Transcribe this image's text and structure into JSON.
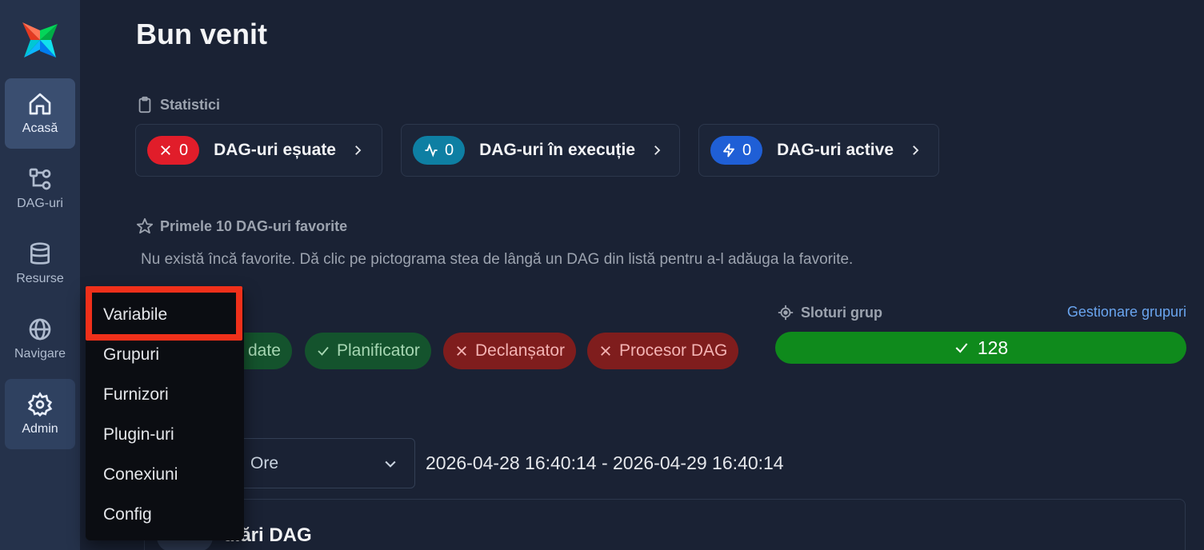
{
  "sidebar": {
    "items": [
      {
        "label": "Acasă",
        "icon": "home-icon"
      },
      {
        "label": "DAG-uri",
        "icon": "dag-icon"
      },
      {
        "label": "Resurse",
        "icon": "database-icon"
      },
      {
        "label": "Navigare",
        "icon": "globe-icon"
      },
      {
        "label": "Admin",
        "icon": "gear-icon"
      }
    ]
  },
  "header": {
    "title": "Bun venit"
  },
  "stats": {
    "label": "Statistici",
    "cards": [
      {
        "count": "0",
        "label": "DAG-uri eșuate",
        "color": "#e11d2a"
      },
      {
        "count": "0",
        "label": "DAG-uri în execuție",
        "color": "#0e7fa3"
      },
      {
        "count": "0",
        "label": "DAG-uri active",
        "color": "#1f5fd6"
      }
    ]
  },
  "favorites": {
    "label": "Primele 10 DAG-uri favorite",
    "empty_message": "Nu există încă favorite. Dă clic pe pictograma stea de lângă un DAG din listă pentru a-l adăuga la favorite."
  },
  "health": {
    "pills": [
      {
        "label": "date",
        "status": "ok"
      },
      {
        "label": "Planificator",
        "status": "ok"
      },
      {
        "label": "Declanșator",
        "status": "fail"
      },
      {
        "label": "Procesor DAG",
        "status": "fail"
      }
    ]
  },
  "pools": {
    "label": "Sloturi grup",
    "manage_link": "Gestionare grupuri",
    "value": "128",
    "color": "#0f8a1c"
  },
  "timerange": {
    "select_value": "Ore",
    "range": "2026-04-28 16:40:14 - 2026-04-29 16:40:14"
  },
  "runs": {
    "title": "ulări DAG"
  },
  "admin_menu": {
    "items": [
      "Variabile",
      "Grupuri",
      "Furnizori",
      "Plugin-uri",
      "Conexiuni",
      "Config"
    ],
    "highlighted": "Variabile",
    "highlight_color": "#f0301a"
  }
}
